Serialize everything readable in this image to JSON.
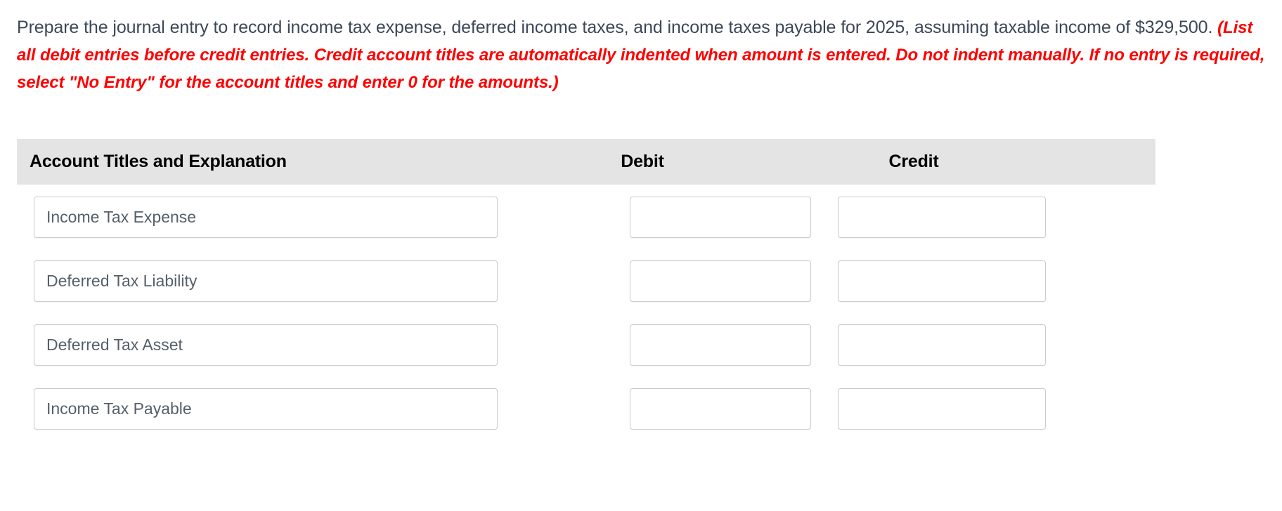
{
  "prompt": {
    "normal_text": "Prepare the journal entry to record income tax expense, deferred income taxes, and income taxes payable for 2025, assuming taxable income of $329,500. ",
    "instruction_text": "(List all debit entries before credit entries. Credit account titles are automatically indented when amount is entered. Do not indent manually. If no entry is required, select \"No Entry\" for the account titles and enter 0 for the amounts.)",
    "instruction_color": "#ff0000",
    "normal_color": "#3c4858"
  },
  "table": {
    "header_background": "#e4e4e4",
    "columns": {
      "account": "Account Titles and Explanation",
      "debit": "Debit",
      "credit": "Credit"
    },
    "rows": [
      {
        "account_title": "Income Tax Expense",
        "debit": "",
        "credit": ""
      },
      {
        "account_title": "Deferred Tax Liability",
        "debit": "",
        "credit": ""
      },
      {
        "account_title": "Deferred Tax Asset",
        "debit": "",
        "credit": ""
      },
      {
        "account_title": "Income Tax Payable",
        "debit": "",
        "credit": ""
      }
    ]
  }
}
